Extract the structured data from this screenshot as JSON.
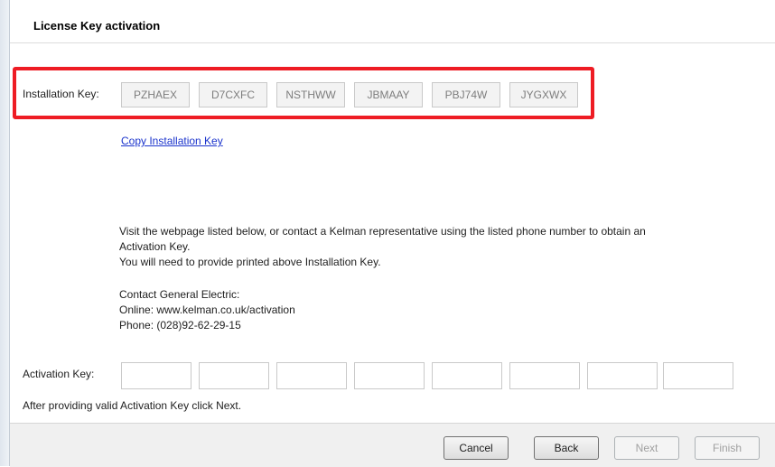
{
  "header": {
    "title": "License Key activation"
  },
  "installation": {
    "label": "Installation Key:",
    "keys": [
      "PZHAEX",
      "D7CXFC",
      "NSTHWW",
      "JBMAAY",
      "PBJ74W",
      "JYGXWX"
    ],
    "copy_link": "Copy Installation Key"
  },
  "info": {
    "line1": "Visit the webpage listed below, or contact a Kelman representative using the listed phone number to obtain an",
    "line2": "Activation Key.",
    "line3": "You will need to provide printed above Installation Key.",
    "contact_title": "Contact General Electric:",
    "online": "Online: www.kelman.co.uk/activation",
    "phone": "Phone: (028)92-62-29-15"
  },
  "activation": {
    "label": "Activation Key:",
    "values": [
      "",
      "",
      "",
      "",
      "",
      "",
      "",
      ""
    ],
    "hint": "After providing valid Activation Key click Next."
  },
  "footer": {
    "cancel": "Cancel",
    "back": "Back",
    "next": "Next",
    "finish": "Finish"
  },
  "colors": {
    "highlight": "#ee1c24",
    "link": "#1a33cc"
  }
}
